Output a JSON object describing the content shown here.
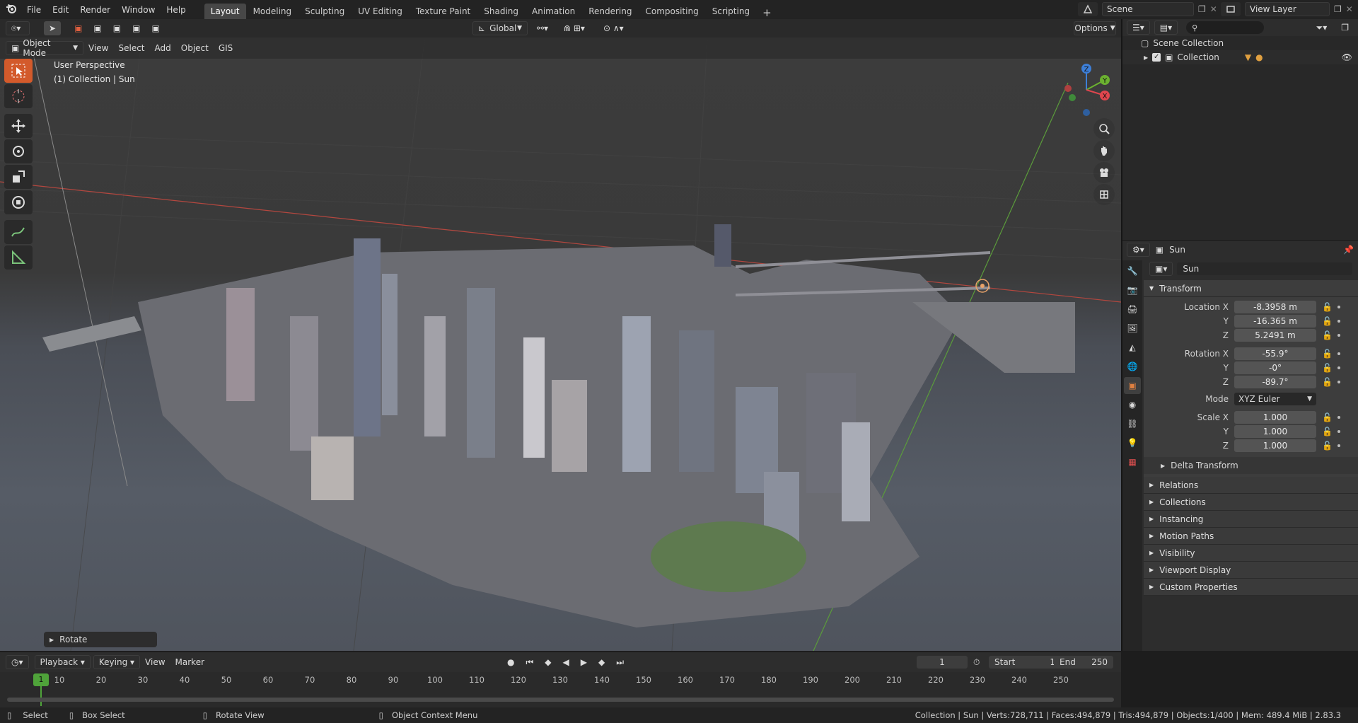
{
  "topbar": {
    "menus": [
      "File",
      "Edit",
      "Render",
      "Window",
      "Help"
    ],
    "workspaces": [
      "Layout",
      "Modeling",
      "Sculpting",
      "UV Editing",
      "Texture Paint",
      "Shading",
      "Animation",
      "Rendering",
      "Compositing",
      "Scripting"
    ],
    "active_workspace": "Layout",
    "scene": "Scene",
    "view_layer": "View Layer"
  },
  "viewport": {
    "mode": "Object Mode",
    "menus": [
      "View",
      "Select",
      "Add",
      "Object",
      "GIS"
    ],
    "transform_orientation": "Global",
    "options_label": "Options",
    "info_line1": "User Perspective",
    "info_line2": "(1) Collection | Sun",
    "last_op": "Rotate",
    "gizmo": {
      "x": "X",
      "y": "Y",
      "z": "Z"
    }
  },
  "outliner": {
    "scene_collection": "Scene Collection",
    "collection": "Collection"
  },
  "properties": {
    "object_name": "Sun",
    "data_name": "Sun",
    "transform_label": "Transform",
    "location_label": "Location X",
    "loc": [
      "-8.3958 m",
      "-16.365 m",
      "5.2491 m"
    ],
    "rotation_label": "Rotation X",
    "rot": [
      "-55.9°",
      "-0°",
      "-89.7°"
    ],
    "mode_label": "Mode",
    "mode_value": "XYZ Euler",
    "scale_label": "Scale X",
    "scale": [
      "1.000",
      "1.000",
      "1.000"
    ],
    "y_label": "Y",
    "z_label": "Z",
    "delta_transform": "Delta Transform",
    "panels": [
      "Relations",
      "Collections",
      "Instancing",
      "Motion Paths",
      "Visibility",
      "Viewport Display",
      "Custom Properties"
    ]
  },
  "timeline": {
    "menus": [
      "Playback",
      "Keying",
      "View",
      "Marker"
    ],
    "current_frame": "1",
    "start_label": "Start",
    "start": "1",
    "end_label": "End",
    "end": "250",
    "ruler_ticks": [
      "10",
      "20",
      "30",
      "40",
      "50",
      "60",
      "70",
      "80",
      "90",
      "100",
      "110",
      "120",
      "130",
      "140",
      "150",
      "160",
      "170",
      "180",
      "190",
      "200",
      "210",
      "220",
      "230",
      "240",
      "250"
    ],
    "playhead": "1"
  },
  "statusbar": {
    "select": "Select",
    "box_select": "Box Select",
    "rotate_view": "Rotate View",
    "context_menu": "Object Context Menu",
    "stats": "Collection | Sun | Verts:728,711 | Faces:494,879 | Tris:494,879 | Objects:1/400 | Mem: 489.4 MiB | 2.83.3"
  },
  "colors": {
    "accent": "#d35a2b",
    "active_tab": "#474747",
    "gizmo_x": "#e0464e",
    "gizmo_y": "#6bb130",
    "gizmo_z": "#3d7fd8",
    "playhead": "#4fa33a"
  }
}
